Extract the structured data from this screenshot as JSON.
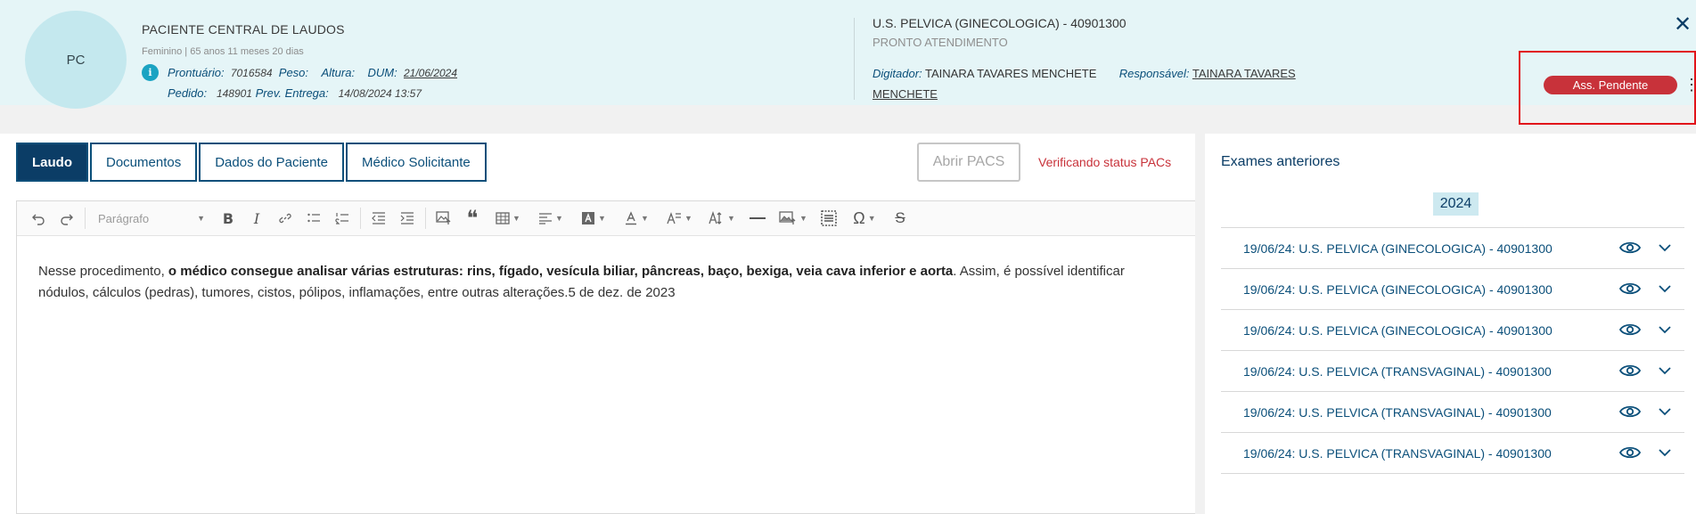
{
  "header": {
    "avatar_initials": "PC",
    "patient_name": "PACIENTE CENTRAL DE LAUDOS",
    "patient_sub": "Feminino | 65 anos 11 meses 20 dias",
    "info_icon": "i",
    "prontuario_label": "Prontuário:",
    "prontuario_value": "7016584",
    "peso_label": "Peso:",
    "altura_label": "Altura:",
    "dum_label": "DUM:",
    "dum_value": "21/06/2024",
    "pedido_label": "Pedido:",
    "pedido_value": "148901",
    "prev_label": "Prev. Entrega:",
    "prev_value": "14/08/2024 13:57",
    "exam_title": "U.S. PELVICA (GINECOLOGICA) - 40901300",
    "exam_sub": "PRONTO ATENDIMENTO",
    "digitador_label": "Digitador:",
    "digitador_value": "TAINARA TAVARES MENCHETE",
    "responsavel_label": "Responsável:",
    "responsavel_value_1": "TAINARA TAVARES",
    "responsavel_value_2": "MENCHETE",
    "close": "✕",
    "status_badge": "Ass. Pendente",
    "menu": "⋮"
  },
  "tabs": [
    "Laudo",
    "Documentos",
    "Dados do Paciente",
    "Médico Solicitante"
  ],
  "pacs": {
    "button": "Abrir PACS",
    "status": "Verificando status PACs"
  },
  "toolbar": {
    "paragraph_label": "Parágrafo",
    "icons": [
      "undo-icon",
      "redo-icon",
      "bold-icon",
      "italic-icon",
      "link-icon",
      "bulleted-list-icon",
      "numbered-list-icon",
      "outdent-icon",
      "indent-icon",
      "upload-image-icon",
      "blockquote-icon",
      "table-icon",
      "align-icon",
      "highlight-icon",
      "font-color-icon",
      "font-size-icon",
      "text-case-icon",
      "horizontal-line-icon",
      "insert-image-icon",
      "select-all-icon",
      "special-chars-icon",
      "strikethrough-icon"
    ]
  },
  "editor": {
    "text_before": " Nesse procedimento, ",
    "text_bold": "o médico consegue analisar várias estruturas: rins, fígado, vesícula biliar, pâncreas, baço, bexiga, veia cava inferior e aorta",
    "text_after": ". Assim, é possível identificar nódulos, cálculos (pedras), tumores, cistos, pólipos, inflamações, entre outras alterações.5 de dez. de 2023"
  },
  "previous_exams": {
    "title": "Exames anteriores",
    "year": "2024",
    "items": [
      "19/06/24: U.S. PELVICA (GINECOLOGICA) - 40901300",
      "19/06/24: U.S. PELVICA (GINECOLOGICA) - 40901300",
      "19/06/24: U.S. PELVICA (GINECOLOGICA) - 40901300",
      "19/06/24: U.S. PELVICA (TRANSVAGINAL) - 40901300",
      "19/06/24: U.S. PELVICA (TRANSVAGINAL) - 40901300",
      "19/06/24: U.S. PELVICA (TRANSVAGINAL) - 40901300"
    ]
  },
  "colors": {
    "header_bg": "#e5f5f7",
    "primary": "#0b3d66",
    "badge": "#c8323a",
    "highlight_box": "#e1141a"
  }
}
